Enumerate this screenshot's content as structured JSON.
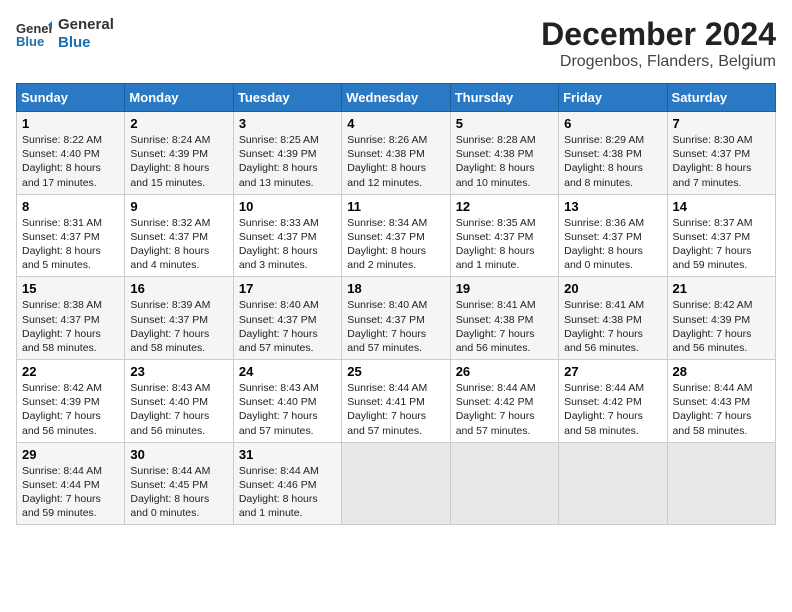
{
  "logo": {
    "line1": "General",
    "line2": "Blue"
  },
  "title": "December 2024",
  "subtitle": "Drogenbos, Flanders, Belgium",
  "days_of_week": [
    "Sunday",
    "Monday",
    "Tuesday",
    "Wednesday",
    "Thursday",
    "Friday",
    "Saturday"
  ],
  "weeks": [
    [
      {
        "day": "1",
        "info": "Sunrise: 8:22 AM\nSunset: 4:40 PM\nDaylight: 8 hours and 17 minutes."
      },
      {
        "day": "2",
        "info": "Sunrise: 8:24 AM\nSunset: 4:39 PM\nDaylight: 8 hours and 15 minutes."
      },
      {
        "day": "3",
        "info": "Sunrise: 8:25 AM\nSunset: 4:39 PM\nDaylight: 8 hours and 13 minutes."
      },
      {
        "day": "4",
        "info": "Sunrise: 8:26 AM\nSunset: 4:38 PM\nDaylight: 8 hours and 12 minutes."
      },
      {
        "day": "5",
        "info": "Sunrise: 8:28 AM\nSunset: 4:38 PM\nDaylight: 8 hours and 10 minutes."
      },
      {
        "day": "6",
        "info": "Sunrise: 8:29 AM\nSunset: 4:38 PM\nDaylight: 8 hours and 8 minutes."
      },
      {
        "day": "7",
        "info": "Sunrise: 8:30 AM\nSunset: 4:37 PM\nDaylight: 8 hours and 7 minutes."
      }
    ],
    [
      {
        "day": "8",
        "info": "Sunrise: 8:31 AM\nSunset: 4:37 PM\nDaylight: 8 hours and 5 minutes."
      },
      {
        "day": "9",
        "info": "Sunrise: 8:32 AM\nSunset: 4:37 PM\nDaylight: 8 hours and 4 minutes."
      },
      {
        "day": "10",
        "info": "Sunrise: 8:33 AM\nSunset: 4:37 PM\nDaylight: 8 hours and 3 minutes."
      },
      {
        "day": "11",
        "info": "Sunrise: 8:34 AM\nSunset: 4:37 PM\nDaylight: 8 hours and 2 minutes."
      },
      {
        "day": "12",
        "info": "Sunrise: 8:35 AM\nSunset: 4:37 PM\nDaylight: 8 hours and 1 minute."
      },
      {
        "day": "13",
        "info": "Sunrise: 8:36 AM\nSunset: 4:37 PM\nDaylight: 8 hours and 0 minutes."
      },
      {
        "day": "14",
        "info": "Sunrise: 8:37 AM\nSunset: 4:37 PM\nDaylight: 7 hours and 59 minutes."
      }
    ],
    [
      {
        "day": "15",
        "info": "Sunrise: 8:38 AM\nSunset: 4:37 PM\nDaylight: 7 hours and 58 minutes."
      },
      {
        "day": "16",
        "info": "Sunrise: 8:39 AM\nSunset: 4:37 PM\nDaylight: 7 hours and 58 minutes."
      },
      {
        "day": "17",
        "info": "Sunrise: 8:40 AM\nSunset: 4:37 PM\nDaylight: 7 hours and 57 minutes."
      },
      {
        "day": "18",
        "info": "Sunrise: 8:40 AM\nSunset: 4:37 PM\nDaylight: 7 hours and 57 minutes."
      },
      {
        "day": "19",
        "info": "Sunrise: 8:41 AM\nSunset: 4:38 PM\nDaylight: 7 hours and 56 minutes."
      },
      {
        "day": "20",
        "info": "Sunrise: 8:41 AM\nSunset: 4:38 PM\nDaylight: 7 hours and 56 minutes."
      },
      {
        "day": "21",
        "info": "Sunrise: 8:42 AM\nSunset: 4:39 PM\nDaylight: 7 hours and 56 minutes."
      }
    ],
    [
      {
        "day": "22",
        "info": "Sunrise: 8:42 AM\nSunset: 4:39 PM\nDaylight: 7 hours and 56 minutes."
      },
      {
        "day": "23",
        "info": "Sunrise: 8:43 AM\nSunset: 4:40 PM\nDaylight: 7 hours and 56 minutes."
      },
      {
        "day": "24",
        "info": "Sunrise: 8:43 AM\nSunset: 4:40 PM\nDaylight: 7 hours and 57 minutes."
      },
      {
        "day": "25",
        "info": "Sunrise: 8:44 AM\nSunset: 4:41 PM\nDaylight: 7 hours and 57 minutes."
      },
      {
        "day": "26",
        "info": "Sunrise: 8:44 AM\nSunset: 4:42 PM\nDaylight: 7 hours and 57 minutes."
      },
      {
        "day": "27",
        "info": "Sunrise: 8:44 AM\nSunset: 4:42 PM\nDaylight: 7 hours and 58 minutes."
      },
      {
        "day": "28",
        "info": "Sunrise: 8:44 AM\nSunset: 4:43 PM\nDaylight: 7 hours and 58 minutes."
      }
    ],
    [
      {
        "day": "29",
        "info": "Sunrise: 8:44 AM\nSunset: 4:44 PM\nDaylight: 7 hours and 59 minutes."
      },
      {
        "day": "30",
        "info": "Sunrise: 8:44 AM\nSunset: 4:45 PM\nDaylight: 8 hours and 0 minutes."
      },
      {
        "day": "31",
        "info": "Sunrise: 8:44 AM\nSunset: 4:46 PM\nDaylight: 8 hours and 1 minute."
      },
      {
        "day": "",
        "info": ""
      },
      {
        "day": "",
        "info": ""
      },
      {
        "day": "",
        "info": ""
      },
      {
        "day": "",
        "info": ""
      }
    ]
  ]
}
